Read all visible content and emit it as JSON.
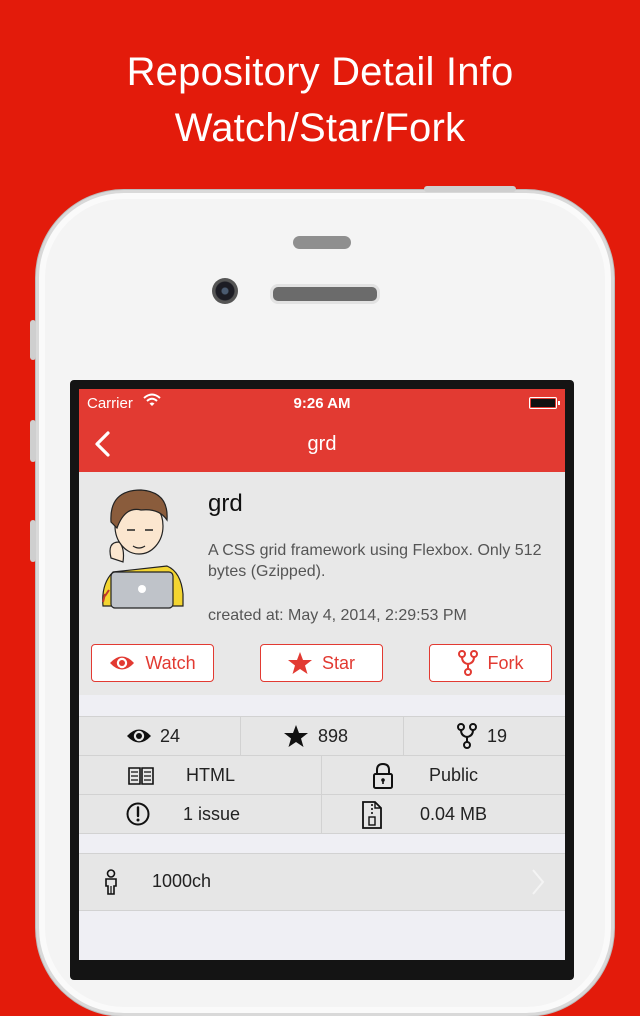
{
  "headline": {
    "line1": "Repository Detail Info",
    "line2": "Watch/Star/Fork"
  },
  "status_bar": {
    "carrier": "Carrier",
    "time": "9:26 AM"
  },
  "nav": {
    "title": "grd"
  },
  "repo": {
    "name": "grd",
    "description": "A CSS grid framework using Flexbox. Only 512 bytes (Gzipped).",
    "created": "created at: May 4, 2014, 2:29:53 PM"
  },
  "actions": {
    "watch": "Watch",
    "star": "Star",
    "fork": "Fork"
  },
  "stats": {
    "watchers": "24",
    "stars": "898",
    "forks": "19",
    "language": "HTML",
    "visibility": "Public",
    "issues": "1 issue",
    "size": "0.04 MB"
  },
  "owner": {
    "login": "1000ch"
  },
  "colors": {
    "background": "#e31b0b",
    "accent": "#e23a32"
  },
  "icons": [
    "wifi-icon",
    "battery-icon",
    "back-chevron-icon",
    "eye-icon",
    "star-icon",
    "fork-icon",
    "book-icon",
    "lock-icon",
    "alert-circle-icon",
    "zip-file-icon",
    "person-icon",
    "chevron-right-icon"
  ]
}
